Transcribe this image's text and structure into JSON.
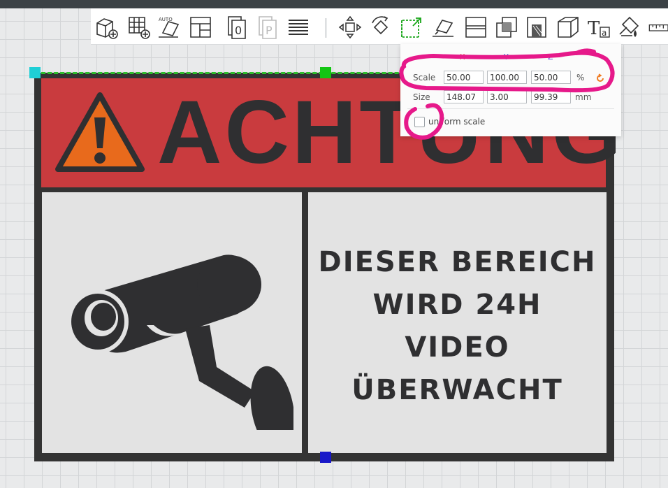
{
  "toolbar": {
    "tools": [
      {
        "name": "add-box-icon"
      },
      {
        "name": "add-grid-icon"
      },
      {
        "name": "auto-arrange-icon",
        "label": "AUTO"
      },
      {
        "name": "layout-icon"
      },
      {
        "name": "plate-0-icon",
        "label": "0"
      },
      {
        "name": "plate-p-icon",
        "label": "P"
      },
      {
        "name": "layers-icon"
      },
      {
        "name": "move-icon"
      },
      {
        "name": "rotate-icon"
      },
      {
        "name": "scale-icon"
      },
      {
        "name": "lay-flat-icon"
      },
      {
        "name": "cut-icon"
      },
      {
        "name": "boolean-icon"
      },
      {
        "name": "support-paint-icon"
      },
      {
        "name": "box-3d-icon"
      },
      {
        "name": "text-icon",
        "label": "Ta"
      },
      {
        "name": "paint-bucket-icon"
      },
      {
        "name": "measure-icon"
      }
    ]
  },
  "sign": {
    "header_text": "ACHTUNG",
    "message_lines": [
      "DIESER BEREICH",
      "WIRD 24H",
      "VIDEO",
      "ÜBERWACHT"
    ],
    "colors": {
      "header": "#c93b3e",
      "dark": "#333333",
      "panel": "#e3e3e3",
      "warning": "#e86a1c"
    }
  },
  "scale_panel": {
    "axes": [
      "X",
      "Y",
      "Z"
    ],
    "axis_colors": [
      "#e05a3a",
      "#2f6fd6",
      "#5a3fd0"
    ],
    "scale_label": "Scale",
    "scale_values": {
      "x": "50.00",
      "y": "100.00",
      "z": "50.00"
    },
    "scale_unit": "%",
    "size_label": "Size",
    "size_values": {
      "x": "148.07",
      "y": "3.00",
      "z": "99.39"
    },
    "size_unit": "mm",
    "uniform_label": "uniform scale",
    "uniform_checked": false
  },
  "selection": {
    "colors": {
      "x_handle": "#1fcfd6",
      "y_handle": "#13c613",
      "z_handle": "#1818c8",
      "line": "#2cbd2c"
    }
  },
  "annotation": {
    "color": "#e6198a"
  }
}
